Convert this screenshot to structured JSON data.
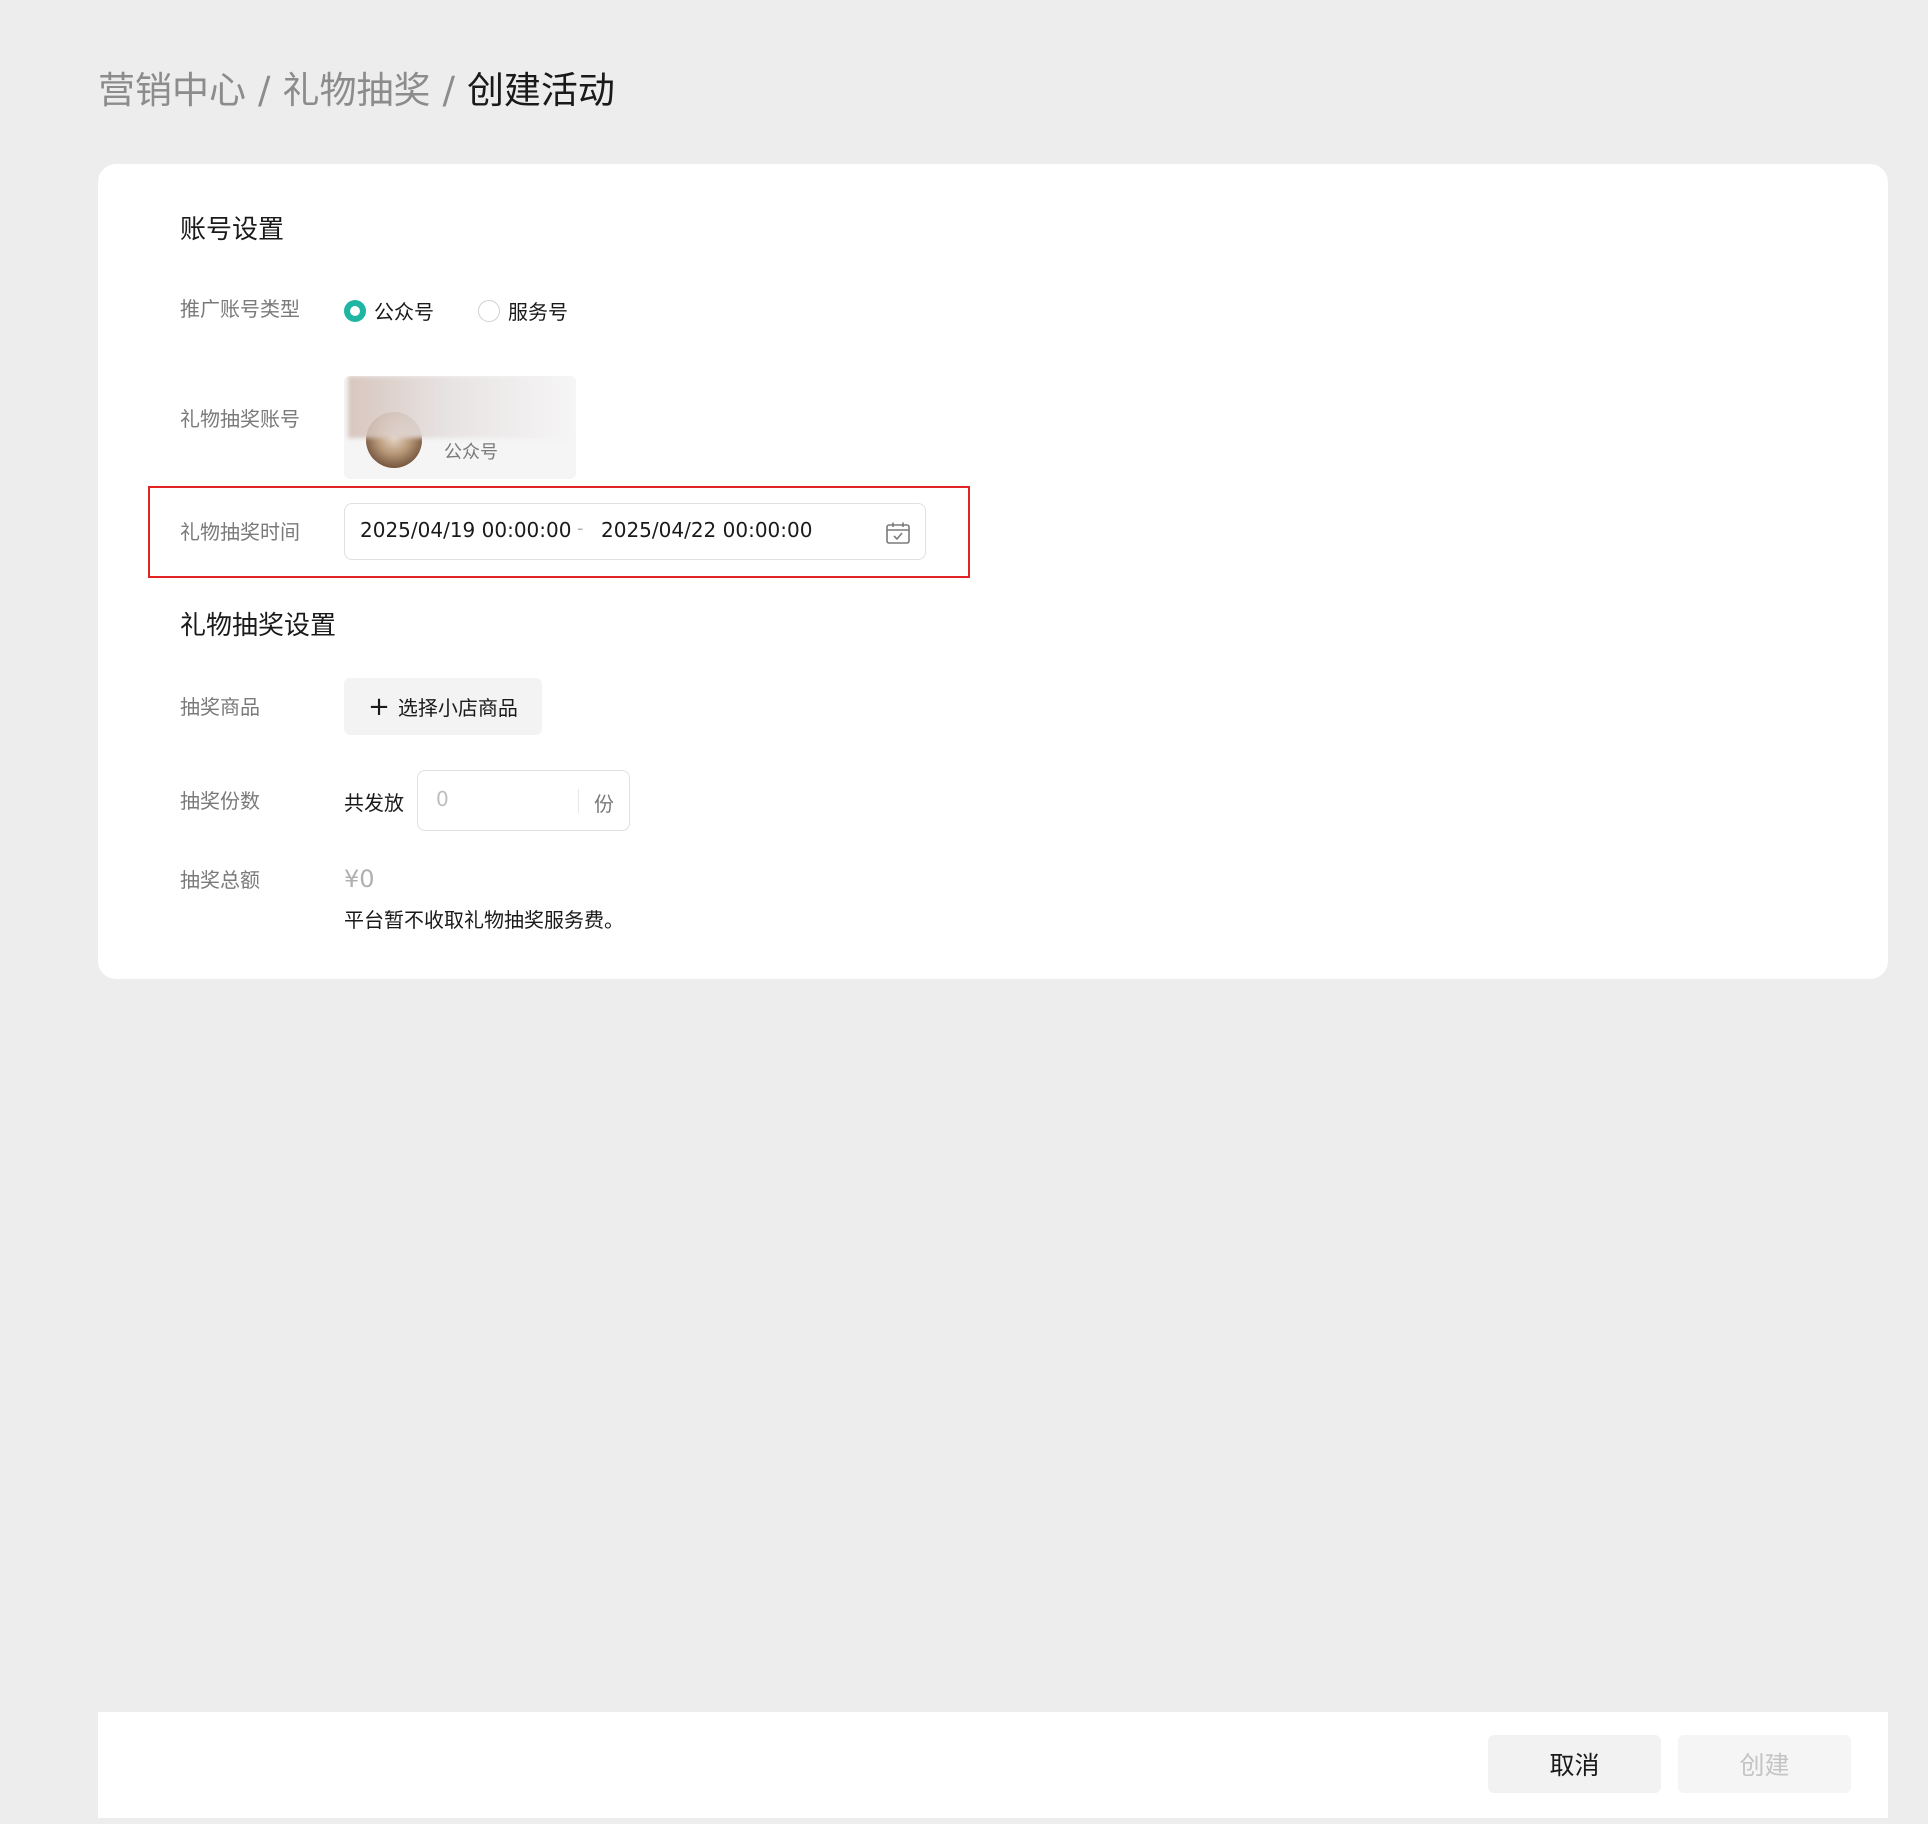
{
  "breadcrumb": {
    "items": [
      "营销中心",
      "礼物抽奖"
    ],
    "separator": "/",
    "current": "创建活动"
  },
  "account_settings": {
    "title": "账号设置",
    "account_type": {
      "label": "推广账号类型",
      "options": [
        "公众号",
        "服务号"
      ],
      "selected": "公众号"
    },
    "lottery_account": {
      "label": "礼物抽奖账号",
      "account_type_text": "公众号"
    },
    "lottery_time": {
      "label": "礼物抽奖时间",
      "start": "2025/04/19 00:00:00",
      "separator": "-",
      "end": "2025/04/22 00:00:00",
      "icon": "calendar-icon"
    }
  },
  "lottery_settings": {
    "title": "礼物抽奖设置",
    "product": {
      "label": "抽奖商品",
      "button_label": "选择小店商品",
      "button_icon": "plus-icon"
    },
    "quantity": {
      "label": "抽奖份数",
      "prefix": "共发放",
      "placeholder": "0",
      "value": "",
      "suffix": "份"
    },
    "total": {
      "label": "抽奖总额",
      "value": "¥0",
      "note": "平台暂不收取礼物抽奖服务费。"
    }
  },
  "footer": {
    "cancel_label": "取消",
    "create_label": "创建"
  },
  "colors": {
    "accent": "#1eb6a3",
    "highlight_border": "#e02424",
    "page_background": "#ededed"
  }
}
